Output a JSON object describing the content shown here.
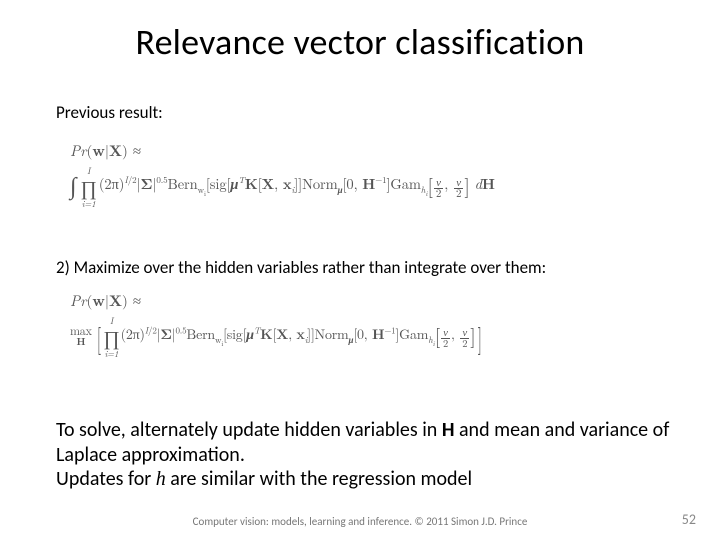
{
  "title": "Relevance vector classification",
  "label_previous": "Previous result:",
  "label_step2": "2) Maximize over the hidden variables rather than integrate over them:",
  "eq_lhs": "Pr(w|X) ≈",
  "paragraph": {
    "line1a": "To solve, alternately update hidden variables in ",
    "H": "H",
    "line1b": " and mean and variance of Laplace approximation.",
    "line2a": "Updates for ",
    "h": "h",
    "line2b": " are similar with the regression model"
  },
  "footer": "Computer vision: models, learning and inference.   © 2011 Simon J.D. Prince",
  "page_number": "52",
  "equations": {
    "eq1_latex": "\\int \\prod_{i=1}^{I} (2\\pi)^{I/2} |\\Sigma|^{0.5} \\mathrm{Bern}_{w_i}[\\mathrm{sig}[\\boldsymbol{\\mu}^T \\mathbf{K}[\\mathbf{X},\\mathbf{x}_i]] \\mathrm{Norm}_{\\boldsymbol{\\mu}}[0,\\mathbf{H}^{-1}] \\mathrm{Gam}_{h_i}\\left[\\frac{\\nu}{2},\\frac{\\nu}{2}\\right] d\\mathbf{H}",
    "eq2_latex": "\\max_{\\mathbf{H}} \\left[ \\prod_{i=1}^{I} (2\\pi)^{I/2} |\\Sigma|^{0.5} \\mathrm{Bern}_{w_i}[\\mathrm{sig}[\\boldsymbol{\\mu}^T \\mathbf{K}[\\mathbf{X},\\mathbf{x}_i]] \\mathrm{Norm}_{\\boldsymbol{\\mu}}[0,\\mathbf{H}^{-1}] \\mathrm{Gam}_{h_i}\\left[\\frac{\\nu}{2},\\frac{\\nu}{2}\\right] \\right]"
  }
}
